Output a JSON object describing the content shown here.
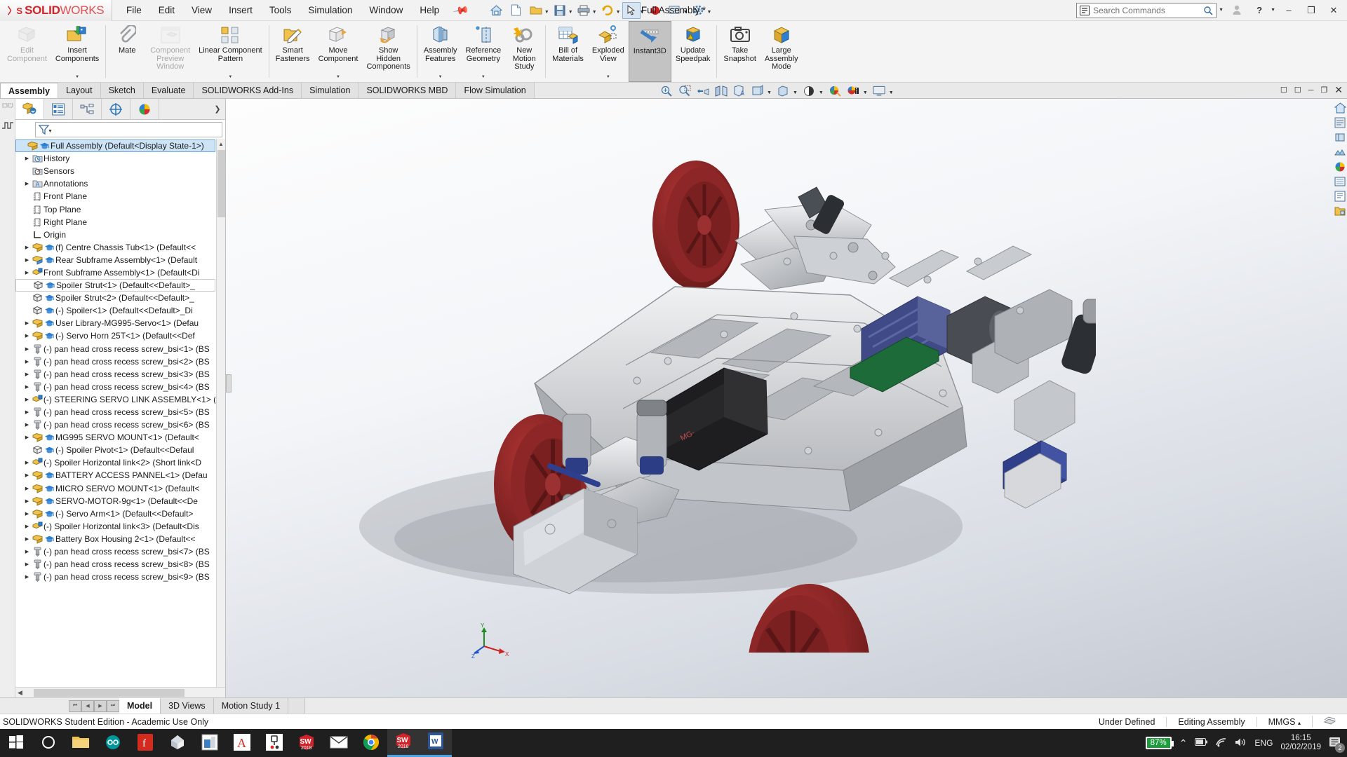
{
  "titlebar": {
    "app_name_bold": "SOLID",
    "app_name_light": "WORKS",
    "document_title": "Full Assembly *",
    "menu": [
      "File",
      "Edit",
      "View",
      "Insert",
      "Tools",
      "Simulation",
      "Window",
      "Help"
    ],
    "pin_icon": "pin-icon",
    "quick_access": [
      "home-icon",
      "new-doc-icon",
      "open-folder-icon",
      "save-icon",
      "print-icon",
      "undo-icon",
      "select-icon",
      "rebuild-icon",
      "options-gear-icon"
    ],
    "search": {
      "placeholder": "Search Commands",
      "icon": "search-icon"
    },
    "account_icon": "user-account-icon",
    "help_icon": "help-icon",
    "minimize": "–",
    "restore": "❐",
    "close": "✕"
  },
  "ribbon": {
    "buttons": [
      {
        "label": "Edit\nComponent",
        "icon": "edit-component-icon",
        "disabled": true,
        "dropdown": false
      },
      {
        "label": "Insert\nComponents",
        "icon": "insert-components-icon",
        "disabled": false,
        "dropdown": true
      },
      {
        "label": "Mate",
        "icon": "mate-paperclip-icon",
        "disabled": false,
        "dropdown": false
      },
      {
        "label": "Component\nPreview\nWindow",
        "icon": "component-preview-icon",
        "disabled": true,
        "dropdown": false
      },
      {
        "label": "Linear Component\nPattern",
        "icon": "linear-pattern-icon",
        "disabled": false,
        "dropdown": true
      },
      {
        "label": "Smart\nFasteners",
        "icon": "smart-fasteners-icon",
        "disabled": false,
        "dropdown": false
      },
      {
        "label": "Move\nComponent",
        "icon": "move-component-icon",
        "disabled": false,
        "dropdown": true
      },
      {
        "label": "Show\nHidden\nComponents",
        "icon": "show-hidden-icon",
        "disabled": false,
        "dropdown": false
      },
      {
        "label": "Assembly\nFeatures",
        "icon": "assembly-features-icon",
        "disabled": false,
        "dropdown": true
      },
      {
        "label": "Reference\nGeometry",
        "icon": "reference-geometry-icon",
        "disabled": false,
        "dropdown": true
      },
      {
        "label": "New\nMotion\nStudy",
        "icon": "new-motion-study-icon",
        "disabled": false,
        "dropdown": false
      },
      {
        "label": "Bill of\nMaterials",
        "icon": "bill-of-materials-icon",
        "disabled": false,
        "dropdown": false
      },
      {
        "label": "Exploded\nView",
        "icon": "exploded-view-icon",
        "disabled": false,
        "dropdown": true
      },
      {
        "label": "Instant3D",
        "icon": "instant3d-icon",
        "disabled": false,
        "selected": true,
        "dropdown": false
      },
      {
        "label": "Update\nSpeedpak",
        "icon": "update-speedpak-icon",
        "disabled": false,
        "dropdown": false
      },
      {
        "label": "Take\nSnapshot",
        "icon": "take-snapshot-camera-icon",
        "disabled": false,
        "dropdown": false
      },
      {
        "label": "Large\nAssembly\nMode",
        "icon": "large-assembly-icon",
        "disabled": false,
        "dropdown": false
      }
    ]
  },
  "command_tabs": {
    "items": [
      "Assembly",
      "Layout",
      "Sketch",
      "Evaluate",
      "SOLIDWORKS Add-Ins",
      "Simulation",
      "SOLIDWORKS MBD",
      "Flow Simulation"
    ],
    "active": "Assembly",
    "view_tools": [
      "zoom-to-fit-icon",
      "zoom-to-area-icon",
      "previous-view-icon",
      "section-view-icon",
      "view-orientation-icon",
      "display-style-icon",
      "hide-show-items-icon",
      "edit-appearance-icon",
      "apply-scene-icon",
      "view-settings-icon"
    ],
    "window_controls": [
      "restore-down-icon",
      "maximize-icon",
      "minimize-doc-icon",
      "restore-doc-icon",
      "close-doc-icon"
    ]
  },
  "left_panel": {
    "tabs": [
      "feature-manager-tree-icon",
      "property-manager-icon",
      "configuration-manager-icon",
      "dimxpert-manager-icon",
      "display-manager-icon"
    ],
    "active_tab_index": 0,
    "expand_icon": "chevron-right-icon",
    "filter_icon": "filter-funnel-icon",
    "tree": [
      {
        "label": "Full Assembly  (Default<Display State-1>)",
        "icon": "assembly-icon",
        "badge": "cap-icon",
        "arrow": false,
        "indent": 0,
        "selected": true
      },
      {
        "label": "History",
        "icon": "history-folder-icon",
        "arrow": true,
        "indent": 1
      },
      {
        "label": "Sensors",
        "icon": "sensors-folder-icon",
        "arrow": false,
        "indent": 1
      },
      {
        "label": "Annotations",
        "icon": "annotations-folder-icon",
        "arrow": true,
        "indent": 1
      },
      {
        "label": "Front Plane",
        "icon": "plane-icon",
        "arrow": false,
        "indent": 1
      },
      {
        "label": "Top Plane",
        "icon": "plane-icon",
        "arrow": false,
        "indent": 1
      },
      {
        "label": "Right Plane",
        "icon": "plane-icon",
        "arrow": false,
        "indent": 1
      },
      {
        "label": "Origin",
        "icon": "origin-icon",
        "arrow": false,
        "indent": 1
      },
      {
        "label": "(f) Centre Chassis Tub<1>  (Default<<",
        "icon": "assembly-icon",
        "badge": "cap-icon",
        "arrow": true,
        "indent": 1
      },
      {
        "label": "Rear Subframe Assembly<1>  (Default",
        "icon": "subassembly-icon",
        "badge": "cap-icon",
        "arrow": true,
        "indent": 1
      },
      {
        "label": "Front Subframe Assembly<1>  (Default<Di",
        "icon": "subassembly-blue-icon",
        "arrow": true,
        "indent": 1
      },
      {
        "label": "Spoiler Strut<1>  (Default<<Default>_",
        "icon": "part-icon",
        "badge": "cap-icon",
        "arrow": false,
        "indent": 1,
        "boxed": true
      },
      {
        "label": "Spoiler Strut<2>  (Default<<Default>_",
        "icon": "part-icon",
        "badge": "cap-icon",
        "arrow": false,
        "indent": 1
      },
      {
        "label": "(-) Spoiler<1>  (Default<<Default>_Di",
        "icon": "part-icon",
        "badge": "cap-icon",
        "arrow": false,
        "indent": 1
      },
      {
        "label": "User Library-MG995-Servo<1>  (Defau",
        "icon": "assembly-icon",
        "badge": "cap-icon",
        "arrow": true,
        "indent": 1
      },
      {
        "label": "(-) Servo Horn 25T<1>  (Default<<Def",
        "icon": "assembly-icon",
        "badge": "cap-icon",
        "arrow": true,
        "indent": 1
      },
      {
        "label": "(-) pan head cross recess screw_bsi<1>  (BS",
        "icon": "screw-icon",
        "arrow": true,
        "indent": 1
      },
      {
        "label": "(-) pan head cross recess screw_bsi<2>  (BS",
        "icon": "screw-icon",
        "arrow": true,
        "indent": 1
      },
      {
        "label": "(-) pan head cross recess screw_bsi<3>  (BS",
        "icon": "screw-icon",
        "arrow": true,
        "indent": 1
      },
      {
        "label": "(-) pan head cross recess screw_bsi<4>  (BS",
        "icon": "screw-icon",
        "arrow": true,
        "indent": 1
      },
      {
        "label": "(-) STEERING SERVO LINK ASSEMBLY<1>  (",
        "icon": "subassembly-blue-icon",
        "arrow": true,
        "indent": 1
      },
      {
        "label": "(-) pan head cross recess screw_bsi<5>  (BS",
        "icon": "screw-icon",
        "arrow": true,
        "indent": 1
      },
      {
        "label": "(-) pan head cross recess screw_bsi<6>  (BS",
        "icon": "screw-icon",
        "arrow": true,
        "indent": 1
      },
      {
        "label": "MG995 SERVO MOUNT<1>  (Default<",
        "icon": "assembly-icon",
        "badge": "cap-icon",
        "arrow": true,
        "indent": 1
      },
      {
        "label": "(-) Spoiler Pivot<1>  (Default<<Defaul",
        "icon": "part-icon",
        "badge": "cap-icon",
        "arrow": false,
        "indent": 1
      },
      {
        "label": "(-) Spoiler Horizontal link<2>  (Short link<D",
        "icon": "subassembly-blue-icon",
        "arrow": true,
        "indent": 1
      },
      {
        "label": "BATTERY ACCESS PANNEL<1>  (Defau",
        "icon": "assembly-icon",
        "badge": "cap-icon",
        "arrow": true,
        "indent": 1
      },
      {
        "label": "MICRO SERVO MOUNT<1>  (Default<",
        "icon": "assembly-icon",
        "badge": "cap-icon",
        "arrow": true,
        "indent": 1
      },
      {
        "label": "SERVO-MOTOR-9g<1>  (Default<<De",
        "icon": "assembly-icon",
        "badge": "cap-icon",
        "arrow": true,
        "indent": 1
      },
      {
        "label": "(-) Servo Arm<1>  (Default<<Default>",
        "icon": "assembly-icon",
        "badge": "cap-icon",
        "arrow": true,
        "indent": 1
      },
      {
        "label": "(-) Spoiler Horizontal link<3>  (Default<Dis",
        "icon": "subassembly-blue-icon",
        "arrow": true,
        "indent": 1
      },
      {
        "label": "Battery Box Housing 2<1>  (Default<<",
        "icon": "assembly-icon",
        "badge": "cap-icon",
        "arrow": true,
        "indent": 1
      },
      {
        "label": "(-) pan head cross recess screw_bsi<7>  (BS",
        "icon": "screw-icon",
        "arrow": true,
        "indent": 1
      },
      {
        "label": "(-) pan head cross recess screw_bsi<8>  (BS",
        "icon": "screw-icon",
        "arrow": true,
        "indent": 1
      },
      {
        "label": "(-) pan head cross recess screw_bsi<9>  (BS",
        "icon": "screw-icon",
        "arrow": true,
        "indent": 1
      }
    ]
  },
  "viewport": {
    "right_dock": [
      "view-orientation-home-icon",
      "display-panel-icon",
      "appearances-icon",
      "scenes-icon",
      "decals-icon",
      "lights-cameras-icon",
      "custom-properties-icon",
      "design-library-icon"
    ],
    "triad_labels": {
      "x": "X",
      "y": "Y",
      "z": "Z"
    }
  },
  "bottom_tabs": {
    "nav": [
      "first-icon",
      "prev-icon",
      "next-icon",
      "last-icon"
    ],
    "items": [
      "Model",
      "3D Views",
      "Motion Study 1"
    ],
    "active": "Model"
  },
  "status_bar": {
    "edition": "SOLIDWORKS Student Edition - Academic Use Only",
    "state": "Under Defined",
    "mode": "Editing Assembly",
    "units": "MMGS",
    "units_caret": "▴",
    "overlay_icon": "overlay-icon"
  },
  "taskbar": {
    "items": [
      {
        "icon": "windows-start-icon",
        "name": "start-button"
      },
      {
        "icon": "cortana-circle-icon",
        "name": "cortana-button"
      },
      {
        "icon": "file-explorer-icon",
        "name": "file-explorer-button"
      },
      {
        "icon": "arduino-icon",
        "name": "arduino-button"
      },
      {
        "icon": "pdf-icon",
        "name": "pdf-button"
      },
      {
        "icon": "onshape-icon",
        "name": "onshape-button"
      },
      {
        "icon": "store-icon",
        "name": "store-button"
      },
      {
        "icon": "autodesk-icon",
        "name": "autodesk-button"
      },
      {
        "icon": "fritzing-icon",
        "name": "fritzing-button"
      },
      {
        "icon": "solidworks-2018-icon",
        "name": "solidworks-button",
        "label": "2018"
      },
      {
        "icon": "mail-icon",
        "name": "mail-button"
      },
      {
        "icon": "chrome-icon",
        "name": "chrome-button"
      },
      {
        "icon": "solidworks-2018-icon",
        "name": "solidworks-active-button",
        "label": "2018",
        "active": true
      },
      {
        "icon": "word-icon",
        "name": "word-button",
        "active": true
      }
    ],
    "tray": {
      "battery_percent": "87%",
      "chevron": "⌃",
      "battery_icon": "battery-icon",
      "wifi_icon": "wifi-icon",
      "volume_icon": "volume-icon",
      "language": "ENG",
      "time": "16:15",
      "date": "02/02/2019",
      "notifications_count": "2",
      "notifications_icon": "action-center-icon"
    }
  }
}
